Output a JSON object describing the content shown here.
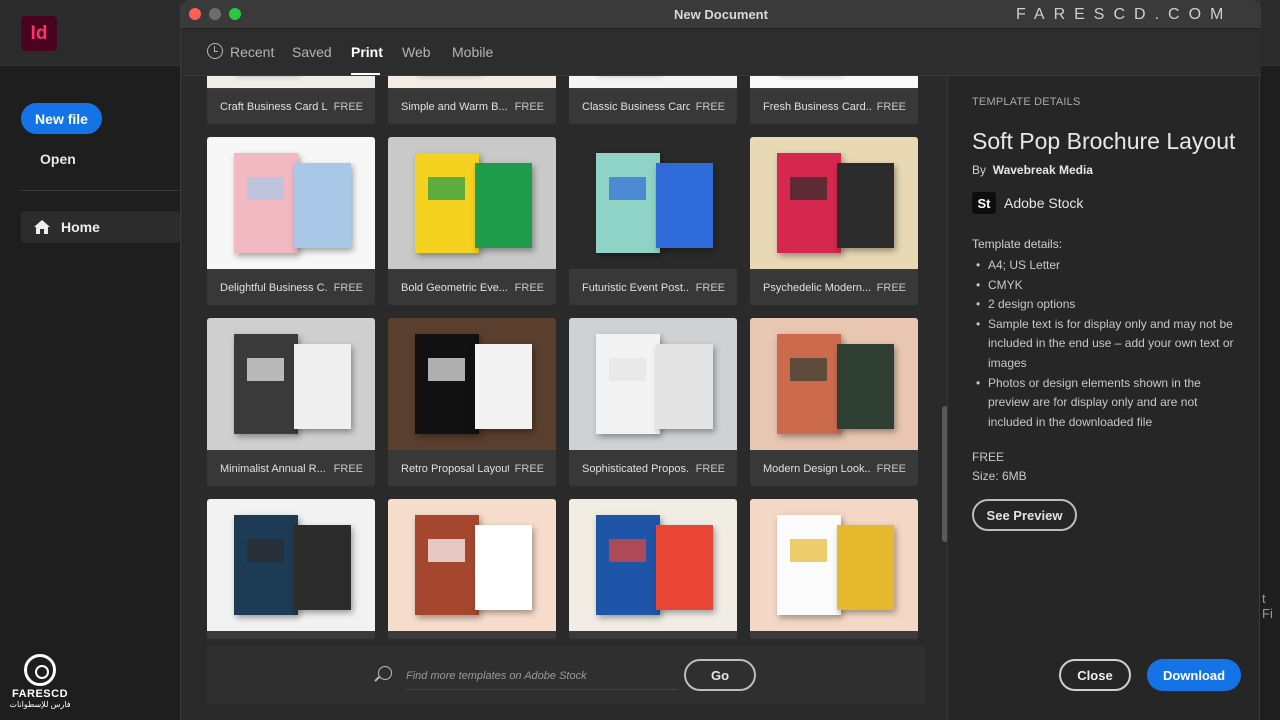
{
  "app": {
    "logo": "Id",
    "new_file": "New file",
    "open": "Open",
    "home": "Home",
    "right_edge_fragment": "t Fi"
  },
  "watermark": {
    "top": "FARESCD.COM",
    "brand_name": "FARESCD",
    "brand_arabic": "فارس للإسطوانات"
  },
  "dialog": {
    "title": "New Document",
    "tabs": [
      {
        "label": "Recent"
      },
      {
        "label": "Saved"
      },
      {
        "label": "Print"
      },
      {
        "label": "Web"
      },
      {
        "label": "Mobile"
      }
    ],
    "active_tab": "Print"
  },
  "templates": [
    {
      "name": "Craft Business Card L...",
      "price": "FREE",
      "palette": [
        "#f0ece6",
        "#d8b89a",
        "#e8e3dc"
      ]
    },
    {
      "name": "Simple and Warm B...",
      "price": "FREE",
      "palette": [
        "#f3ede4",
        "#c7a080",
        "#e2d6c6"
      ]
    },
    {
      "name": "Classic Business Card...",
      "price": "FREE",
      "palette": [
        "#f5f5f5",
        "#2a7a3a",
        "#e8e8e8"
      ]
    },
    {
      "name": "Fresh Business Card...",
      "price": "FREE",
      "palette": [
        "#fafafa",
        "#e0e0e0",
        "#f0f0f0"
      ]
    },
    {
      "name": "Delightful Business C...",
      "price": "FREE",
      "palette": [
        "#f7f7f7",
        "#f3b9c3",
        "#a9c8e8"
      ]
    },
    {
      "name": "Bold Geometric Eve...",
      "price": "FREE",
      "palette": [
        "#c9c9c9",
        "#f5d21f",
        "#1e9b4b"
      ]
    },
    {
      "name": "Futuristic Event Post...",
      "price": "FREE",
      "palette": [
        "#2a2a2a",
        "#8fd3c6",
        "#2f6bd8"
      ]
    },
    {
      "name": "Psychedelic Modern...",
      "price": "FREE",
      "palette": [
        "#e8d8b4",
        "#d6284f",
        "#2b2b2b"
      ]
    },
    {
      "name": "Minimalist Annual R...",
      "price": "FREE",
      "palette": [
        "#cfcfcf",
        "#3a3a3a",
        "#efefef"
      ]
    },
    {
      "name": "Retro Proposal Layout",
      "price": "FREE",
      "palette": [
        "#5a3f2e",
        "#111111",
        "#f2f2f2"
      ]
    },
    {
      "name": "Sophisticated Propos...",
      "price": "FREE",
      "palette": [
        "#cfd2d4",
        "#f3f3f3",
        "#e4e4e4"
      ]
    },
    {
      "name": "Modern Design Look...",
      "price": "FREE",
      "palette": [
        "#e9c6b2",
        "#cc6a4e",
        "#2f3e33"
      ]
    },
    {
      "name": "",
      "price": "",
      "palette": [
        "#f2f2f2",
        "#1d3b54",
        "#2c2c2c"
      ]
    },
    {
      "name": "",
      "price": "",
      "palette": [
        "#f6dccb",
        "#a5472f",
        "#ffffff"
      ]
    },
    {
      "name": "",
      "price": "",
      "palette": [
        "#f1ede5",
        "#1f55a8",
        "#e94537"
      ]
    },
    {
      "name": "",
      "price": "",
      "palette": [
        "#f4d8c5",
        "#fbfbfb",
        "#e6b82d"
      ]
    }
  ],
  "search": {
    "placeholder": "Find more templates on Adobe Stock",
    "go_label": "Go"
  },
  "details": {
    "header": "TEMPLATE DETAILS",
    "title": "Soft Pop Brochure Layout",
    "by_prefix": "By",
    "author": "Wavebreak Media",
    "stock_icon": "St",
    "stock_label": "Adobe Stock",
    "subheading": "Template details:",
    "items": [
      "A4; US Letter",
      "CMYK",
      "2 design options",
      "Sample text is for display only and may not be included in the end use – add your own text or images",
      "Photos or design elements shown in the preview are for display only and are not included in the downloaded file"
    ],
    "price": "FREE",
    "size": "Size:  6MB",
    "see_preview": "See Preview",
    "close": "Close",
    "download": "Download"
  },
  "colors": {
    "accent": "#1473e6",
    "indesign": "#ff3366"
  }
}
